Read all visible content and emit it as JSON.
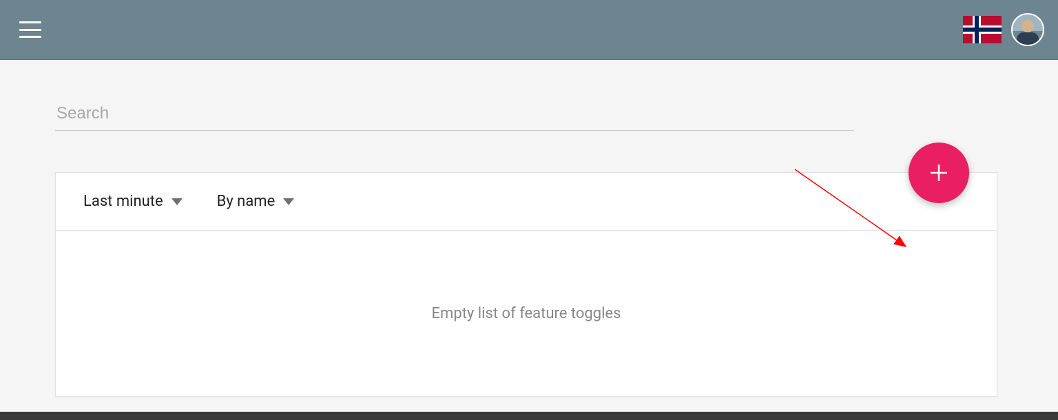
{
  "header": {},
  "search": {
    "placeholder": "Search",
    "value": ""
  },
  "filters": {
    "time": "Last minute",
    "sort": "By name"
  },
  "list": {
    "empty_message": "Empty list of feature toggles"
  },
  "colors": {
    "accent": "#e91e63",
    "header_bg": "#6d8591",
    "annotation_arrow": "#ff0000"
  }
}
